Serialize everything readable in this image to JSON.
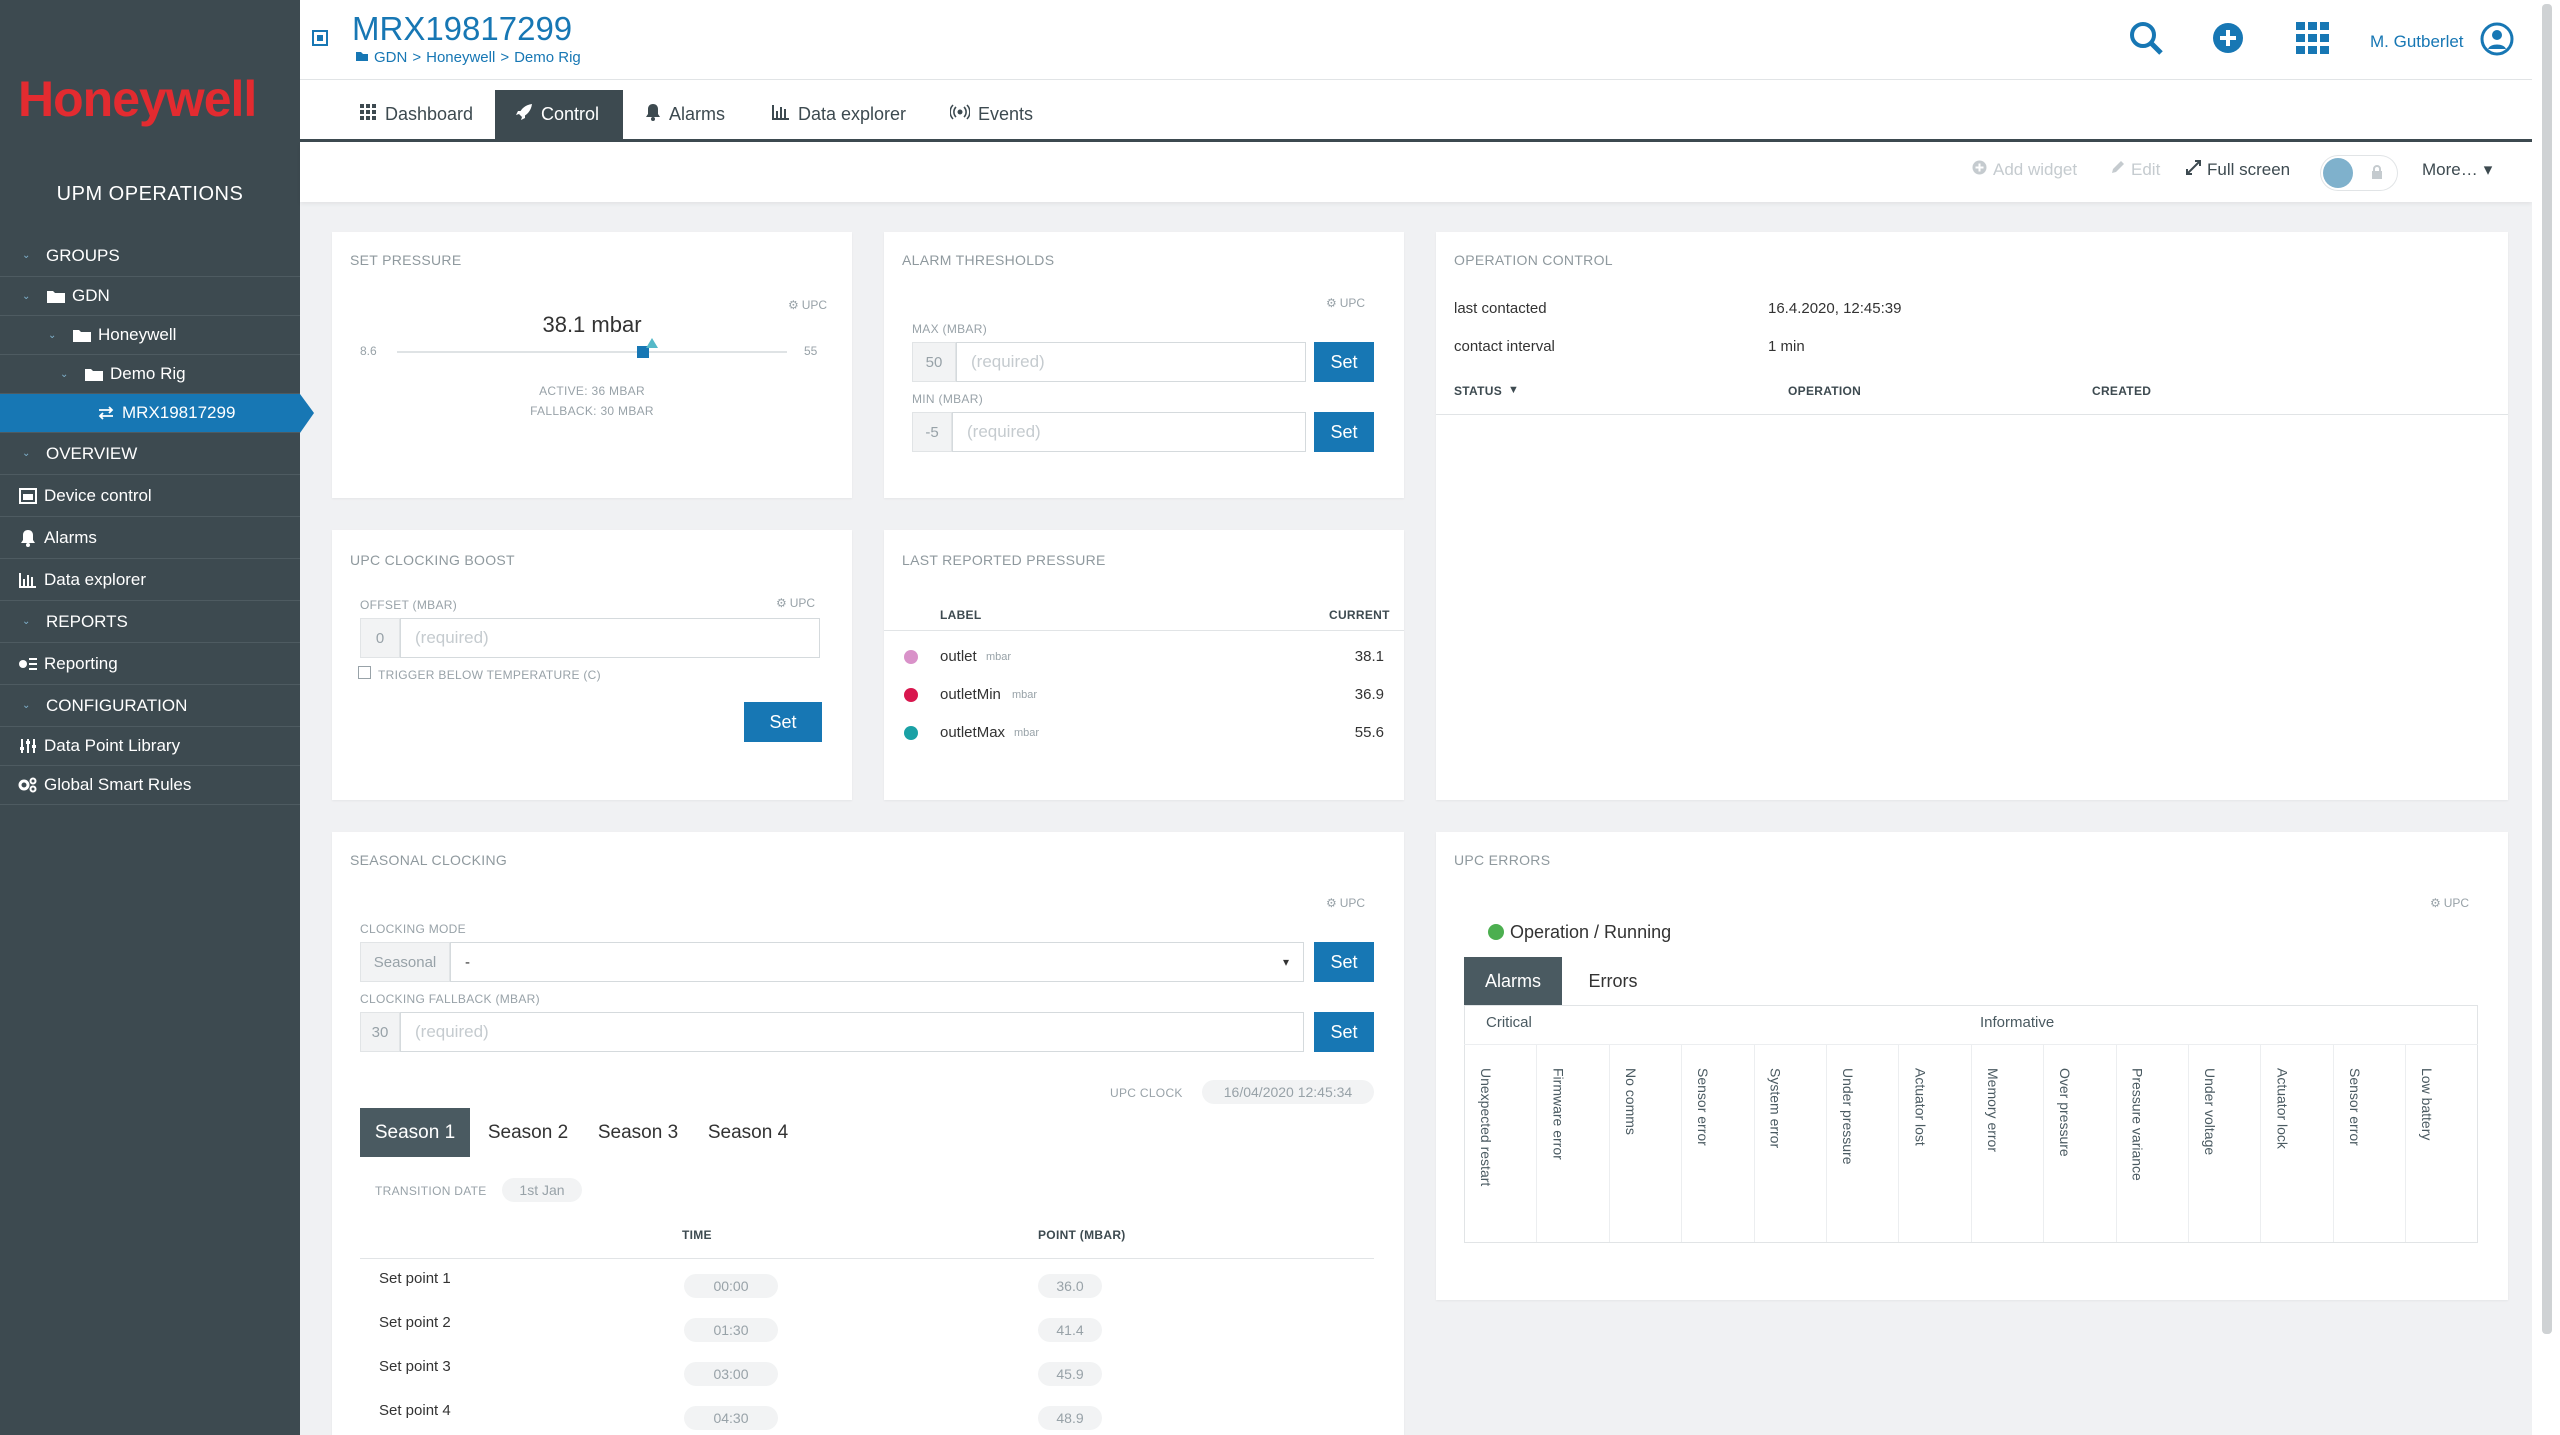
{
  "brand": {
    "logo": "Honeywell",
    "app_title": "UPM OPERATIONS"
  },
  "sidebar": {
    "groups_label": "GROUPS",
    "tree": [
      "GDN",
      "Honeywell",
      "Demo Rig",
      "MRX19817299"
    ],
    "overview_label": "OVERVIEW",
    "overview_items": [
      "Device control",
      "Alarms",
      "Data explorer"
    ],
    "reports_label": "REPORTS",
    "reports_items": [
      "Reporting"
    ],
    "configuration_label": "CONFIGURATION",
    "configuration_items": [
      "Data Point Library",
      "Global Smart Rules"
    ]
  },
  "header": {
    "title": "MRX19817299",
    "breadcrumb": [
      "GDN",
      ">",
      "Honeywell",
      ">",
      "Demo Rig"
    ],
    "user": "M. Gutberlet"
  },
  "tabs": [
    "Dashboard",
    "Control",
    "Alarms",
    "Data explorer",
    "Events"
  ],
  "actions": {
    "add_widget": "Add widget",
    "edit": "Edit",
    "full_screen": "Full screen",
    "more": "More…"
  },
  "set_pressure": {
    "title": "SET PRESSURE",
    "upc": "UPC",
    "value": "38.1 mbar",
    "min": "8.6",
    "max": "55",
    "active": "ACTIVE: 36 MBAR",
    "fallback": "FALLBACK: 30 MBAR",
    "slider_fraction": 0.63,
    "marker_fraction": 0.655
  },
  "alarm_thresholds": {
    "title": "ALARM THRESHOLDS",
    "upc": "UPC",
    "max_label": "MAX (MBAR)",
    "max_value": "50",
    "min_label": "MIN (MBAR)",
    "min_value": "-5",
    "placeholder": "(required)",
    "set": "Set"
  },
  "operation_control": {
    "title": "OPERATION CONTROL",
    "last_contacted_label": "last contacted",
    "last_contacted_value": "16.4.2020, 12:45:39",
    "contact_interval_label": "contact interval",
    "contact_interval_value": "1 min",
    "col_status": "STATUS",
    "col_operation": "OPERATION",
    "col_created": "CREATED"
  },
  "upc_boost": {
    "title": "UPC CLOCKING BOOST",
    "upc": "UPC",
    "offset_label": "OFFSET (MBAR)",
    "offset_value": "0",
    "placeholder": "(required)",
    "trigger_label": "TRIGGER BELOW TEMPERATURE (C)",
    "set": "Set"
  },
  "last_pressure": {
    "title": "LAST REPORTED PRESSURE",
    "col_label": "LABEL",
    "col_current": "CURRENT",
    "rows": [
      {
        "label": "outlet",
        "unit": "mbar",
        "value": "38.1",
        "color": "#d992c9"
      },
      {
        "label": "outletMin",
        "unit": "mbar",
        "value": "36.9",
        "color": "#d8174e"
      },
      {
        "label": "outletMax",
        "unit": "mbar",
        "value": "55.6",
        "color": "#1aa1a5"
      }
    ]
  },
  "seasonal": {
    "title": "SEASONAL CLOCKING",
    "upc": "UPC",
    "mode_label": "CLOCKING MODE",
    "mode_addon": "Seasonal",
    "mode_value": "-",
    "fallback_label": "CLOCKING FALLBACK (MBAR)",
    "fallback_value": "30",
    "placeholder": "(required)",
    "set": "Set",
    "clock_label": "UPC CLOCK",
    "clock_value": "16/04/2020 12:45:34",
    "season_tabs": [
      "Season 1",
      "Season 2",
      "Season 3",
      "Season 4"
    ],
    "transition_label": "TRANSITION DATE",
    "transition_value": "1st Jan",
    "col_time": "TIME",
    "col_point": "POINT (MBAR)",
    "rows": [
      {
        "name": "Set point 1",
        "time": "00:00",
        "point": "36.0"
      },
      {
        "name": "Set point 2",
        "time": "01:30",
        "point": "41.4"
      },
      {
        "name": "Set point 3",
        "time": "03:00",
        "point": "45.9"
      },
      {
        "name": "Set point 4",
        "time": "04:30",
        "point": "48.9"
      }
    ]
  },
  "upc_errors": {
    "title": "UPC ERRORS",
    "upc": "UPC",
    "status": "Operation / Running",
    "status_color": "#4caf50",
    "tabs": [
      "Alarms",
      "Errors"
    ],
    "critical_label": "Critical",
    "informative_label": "Informative",
    "items": [
      "Unexpected restart",
      "Firmware error",
      "No comms",
      "Sensor error",
      "System error",
      "Under pressure",
      "Actuator lost",
      "Memory error",
      "Over pressure",
      "Pressure variance",
      "Under voltage",
      "Actuator lock",
      "Sensor error",
      "Low battery"
    ]
  },
  "colors": {
    "sidebar": "#3d4a50",
    "accent": "#1777b4",
    "brand": "#e32b30"
  }
}
